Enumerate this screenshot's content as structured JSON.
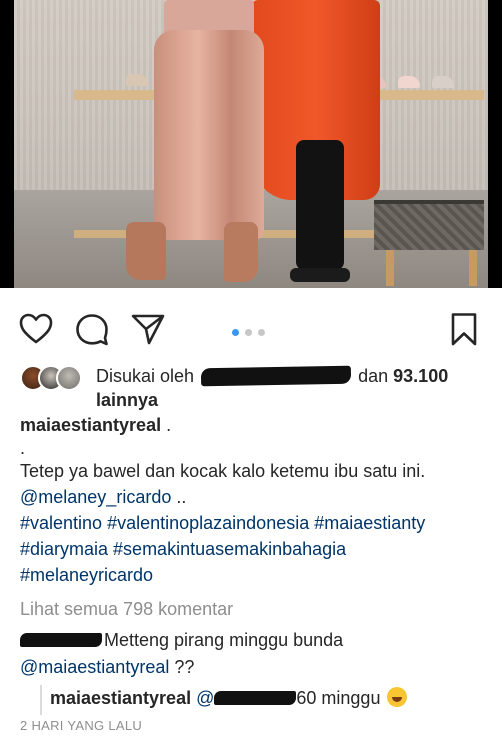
{
  "post": {
    "image_alt": "photo of two women in a shoe store",
    "carousel": {
      "total": 3,
      "active_index": 0
    }
  },
  "actions": {
    "like_icon": "heart-icon",
    "comment_icon": "comment-icon",
    "share_icon": "send-icon",
    "save_icon": "bookmark-icon"
  },
  "likes": {
    "prefix": "Disukai oleh",
    "and": "dan",
    "count": "93.100",
    "suffix": "lainnya"
  },
  "caption": {
    "username": "maiaestiantyreal",
    "after_username": " .",
    "dot_line": ".",
    "text": "Tetep ya bawel dan kocak kalo ketemu ibu satu ini.",
    "mention": "@melaney_ricardo",
    "mention_suffix": " ..",
    "hashtags_line1": "#valentino #valentinoplazaindonesia #maiaestianty",
    "hashtags_line2": "#diarymaia #semakintuasemakinbahagia",
    "hashtags_line3": "#melaneyricardo"
  },
  "comments": {
    "view_all": "Lihat semua 798 komentar",
    "comment1_text": "Metteng pirang minggu bunda",
    "comment1_mention": "@maiaestiantyreal",
    "comment1_suffix": " ??",
    "reply_username": "maiaestiantyreal",
    "reply_mention_prefix": "@",
    "reply_text": "60 minggu"
  },
  "timestamp": "2 HARI YANG LALU",
  "colors": {
    "text": "#262626",
    "link": "#003569",
    "muted": "#8e8e8e",
    "carousel_active": "#3897f0"
  }
}
